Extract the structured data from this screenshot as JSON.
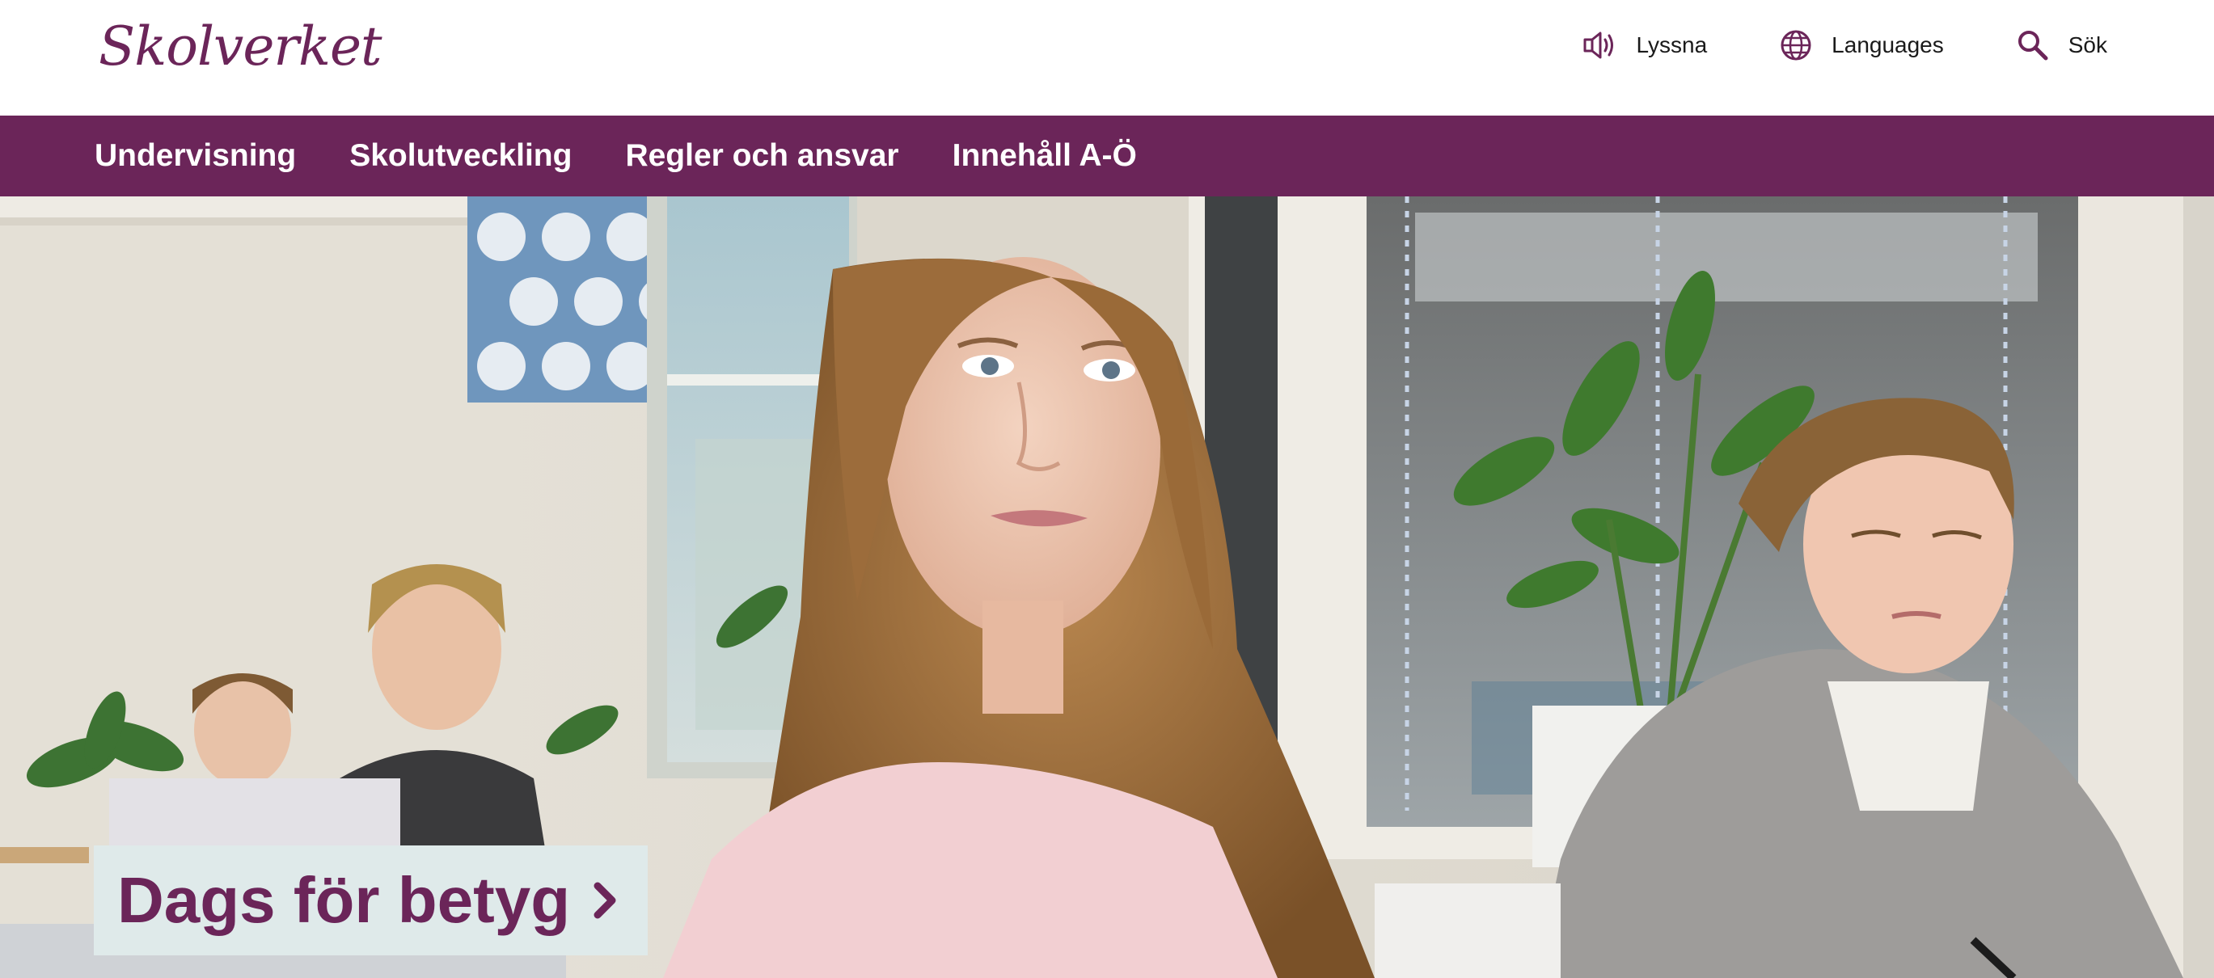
{
  "header": {
    "logo": "Skolverket",
    "tools": [
      {
        "label": "Lyssna",
        "icon": "speaker-icon"
      },
      {
        "label": "Languages",
        "icon": "globe-icon"
      },
      {
        "label": "Sök",
        "icon": "search-icon"
      }
    ]
  },
  "nav": {
    "items": [
      "Undervisning",
      "Skolutveckling",
      "Regler och ansvar",
      "Innehåll A-Ö"
    ]
  },
  "hero": {
    "cta_label": "Dags för betyg",
    "cta_icon": "chevron-right-icon"
  },
  "colors": {
    "brand": "#6b2559",
    "cta_background": "#dfeaea",
    "header_background": "#ffffff"
  }
}
